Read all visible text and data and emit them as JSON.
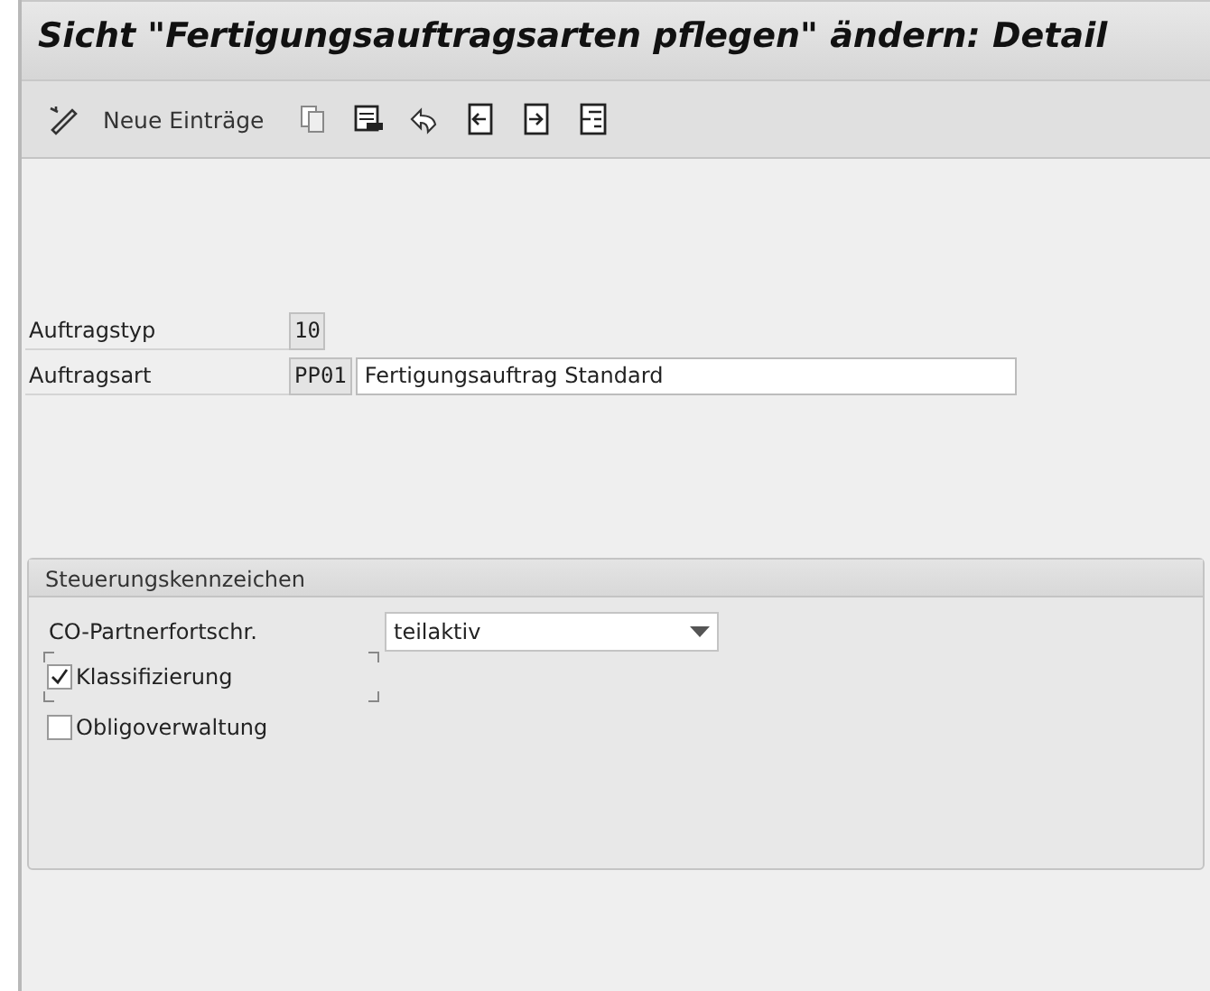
{
  "title": "Sicht \"Fertigungsauftragsarten pflegen\" ändern: Detail",
  "toolbar": {
    "new_entries": "Neue Einträge"
  },
  "fields": [
    {
      "label": "Auftragstyp",
      "code": "10"
    },
    {
      "label": "Auftragsart",
      "code": "PP01",
      "description": "Fertigungsauftrag Standard"
    }
  ],
  "group": {
    "title": "Steuerungskennzeichen",
    "dropdown": {
      "label": "CO-Partnerfortschr.",
      "value": "teilaktiv"
    },
    "checkboxes": [
      {
        "label": "Klassifizierung",
        "checked": true,
        "focused": true
      },
      {
        "label": "Obligoverwaltung",
        "checked": false,
        "focused": false
      }
    ]
  }
}
